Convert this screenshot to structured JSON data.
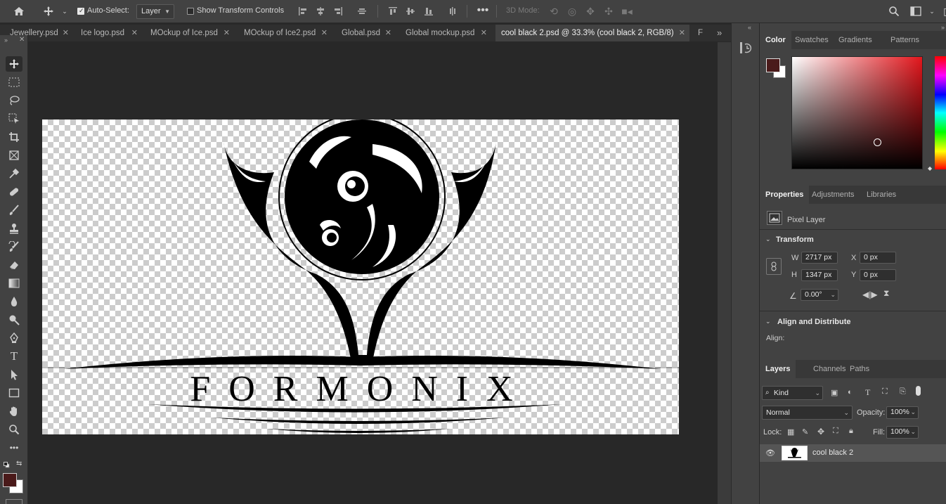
{
  "options_bar": {
    "auto_select_label": "Auto-Select:",
    "auto_select_value": "Layer",
    "transform_controls_label": "Show Transform Controls",
    "mode_3d_label": "3D Mode:"
  },
  "tabs": [
    {
      "label": "Jewellery.psd"
    },
    {
      "label": "Ice logo.psd"
    },
    {
      "label": "MOckup of Ice.psd"
    },
    {
      "label": "MOckup of Ice2.psd"
    },
    {
      "label": "Global.psd"
    },
    {
      "label": "Global mockup.psd"
    },
    {
      "label": "cool black 2.psd @ 33.3% (cool black 2, RGB/8)"
    },
    {
      "label": "F"
    }
  ],
  "color_panel": {
    "tabs": [
      "Color",
      "Swatches",
      "Gradients",
      "Patterns"
    ],
    "foreground": "#4a1a1a",
    "background": "#ffffff"
  },
  "properties_panel": {
    "tabs": [
      "Properties",
      "Adjustments",
      "Libraries"
    ],
    "layer_type": "Pixel Layer",
    "transform_header": "Transform",
    "w_label": "W",
    "w_value": "2717 px",
    "h_label": "H",
    "h_value": "1347 px",
    "x_label": "X",
    "x_value": "0 px",
    "y_label": "Y",
    "y_value": "0 px",
    "angle_value": "0.00°",
    "align_header": "Align and Distribute",
    "align_label": "Align:"
  },
  "layers_panel": {
    "tabs": [
      "Layers",
      "Channels",
      "Paths"
    ],
    "filter_kind": "Kind",
    "blend_mode": "Normal",
    "opacity_label": "Opacity:",
    "opacity_value": "100%",
    "lock_label": "Lock:",
    "fill_label": "Fill:",
    "fill_value": "100%",
    "layers": [
      {
        "name": "cool black 2"
      }
    ]
  },
  "artwork": {
    "brand_text": "FORMONIX"
  }
}
